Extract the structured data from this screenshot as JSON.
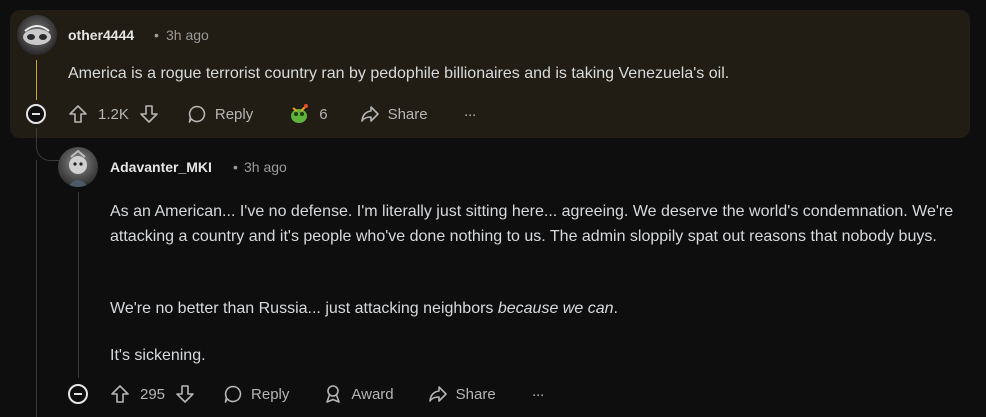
{
  "comments": [
    {
      "username": "other4444",
      "time": "3h ago",
      "body": "America is a rogue terrorist country ran by pedophile billionaires and is taking Venezuela's oil.",
      "votes": "1.2K",
      "reply_label": "Reply",
      "award_count": "6",
      "share_label": "Share",
      "more_label": "···"
    },
    {
      "username": "Adavanter_MKI",
      "time": "3h ago",
      "paragraphs": [
        "As an American... I've no defense. I'm literally just sitting here... agreeing. We deserve the world's condemnation. We're attacking a country and it's people who've done nothing to us. The admin sloppily spat out reasons that nobody buys.",
        "We're no better than Russia... just attacking neighbors ",
        "because we can",
        ".",
        "It's sickening."
      ],
      "votes": "295",
      "reply_label": "Reply",
      "award_label": "Award",
      "share_label": "Share",
      "more_label": "···"
    }
  ],
  "meta_separator": "•",
  "icons": {
    "upvote": "upvote-icon",
    "downvote": "downvote-icon",
    "reply": "reply-icon",
    "award": "award-icon",
    "share": "share-icon",
    "more": "more-icon",
    "collapse": "collapse-icon"
  },
  "colors": {
    "highlight_bg": "#211d14",
    "thread_highlight": "#c8a62f",
    "page_bg": "#0e0e0e"
  }
}
